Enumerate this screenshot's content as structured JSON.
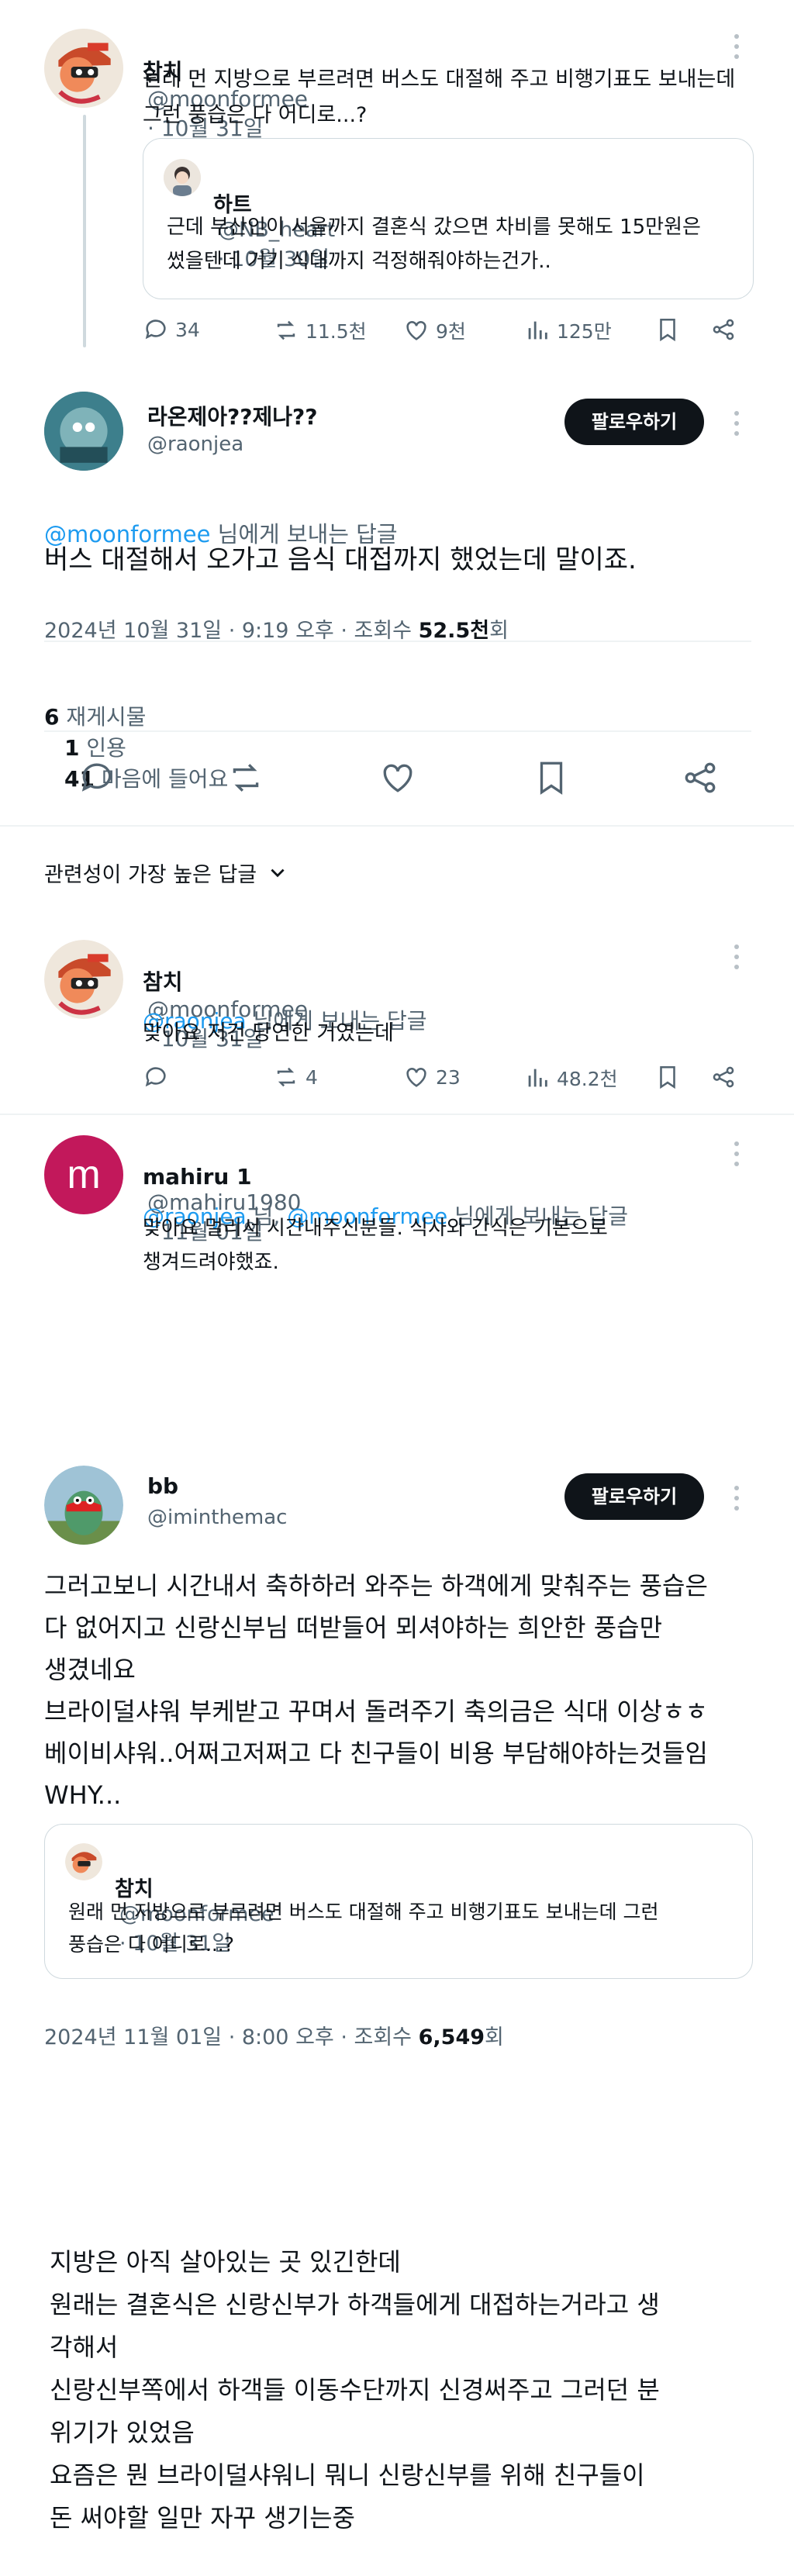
{
  "tweet1": {
    "name": "참치",
    "handle": "@moonformee",
    "date": "· 10월 31일",
    "text": "원래 먼 지방으로 부르려면 버스도 대절해 주고 비행기표도 보내는데\n그런 풍습은 다 어디로...?",
    "quote": {
      "name": "하트",
      "handle": "@NB_heart",
      "date": "· 10월 30일",
      "text": "근데 부산인이 서울까지 결혼식 갔으면 차비를 못해도 15만원은\n썼을텐데 거기 식대까지 걱정해줘야하는건가.."
    },
    "stats": {
      "replies": "34",
      "retweets": "11.5천",
      "likes": "9천",
      "views": "125만"
    }
  },
  "main": {
    "name": "라온제아??제나??",
    "handle": "@raonjea",
    "follow": "팔로우하기",
    "reply_to_handle": "@moonformee",
    "reply_to_suffix": " 님에게 보내는 답글",
    "text": "버스 대절해서 오가고 음식 대접까지 했었는데 말이죠.",
    "meta_prefix": "2024년 10월 31일 · 9:19 오후 · 조회수 ",
    "views": "52.5천",
    "views_suffix": "회",
    "reposts_n": "6",
    "reposts_label": " 재게시물",
    "quotes_n": "1",
    "quotes_label": " 인용",
    "likes_n": "41",
    "likes_label": " 마음에 들어요"
  },
  "sort": {
    "label": "관련성이 가장 높은 답글"
  },
  "reply1": {
    "name": "참치",
    "handle": "@moonformee",
    "date": "· 10월 31일",
    "reply_to_handle": "@raonjea",
    "reply_to_suffix": " 님에게 보내는 답글",
    "text": "맞아요 저건 당연한 거였는데",
    "stats": {
      "retweets": "4",
      "likes": "23",
      "views": "48.2천"
    }
  },
  "reply2": {
    "avatar_letter": "m",
    "name": "mahiru 1",
    "handle": "@mahiru1980",
    "date": "· 11월 01일",
    "reply_to_a": "@raonjea",
    "reply_to_sep": " 님, ",
    "reply_to_b": "@moonformee",
    "reply_to_suffix": " 님에게 보내는 답글",
    "text": "맞아요 멀리서 시간내주신분들. 식사와 간식은 기본으로\n챙겨드려야했죠."
  },
  "tweet2": {
    "name": "bb",
    "handle": "@iminthemac",
    "follow": "팔로우하기",
    "text": "그러고보니 시간내서 축하하러 와주는 하객에게 맞춰주는 풍습은\n다 없어지고 신랑신부님 떠받들어 뫼셔야하는 희안한 풍습만\n생겼네요\n브라이덜샤워 부케받고 꾸며서 돌려주기 축의금은 식대 이상ㅎㅎ\n베이비샤워..어쩌고저쩌고 다 친구들이 비용 부담해야하는것들임\nWHY...",
    "quote": {
      "name": "참치",
      "handle": "@moonformee",
      "date": "· 10월 31일",
      "text": "원래 먼 지방으로 부르려면 버스도 대절해 주고 비행기표도 보내는데 그런\n풍습은 다 어디로...?"
    },
    "meta_prefix": "2024년 11월 01일 · 8:00 오후 · 조회수 ",
    "views": "6,549",
    "views_suffix": "회"
  },
  "note": {
    "text": "지방은 아직 살아있는 곳 있긴한데\n원래는 결혼식은 신랑신부가 하객들에게 대접하는거라고 생\n각해서\n신랑신부쪽에서 하객들 이동수단까지 신경써주고 그러던 분\n위기가 있었음\n요즘은 뭔 브라이덜샤워니 뭐니 신랑신부를 위해 친구들이\n돈 써야할 일만 자꾸 생기는중"
  }
}
